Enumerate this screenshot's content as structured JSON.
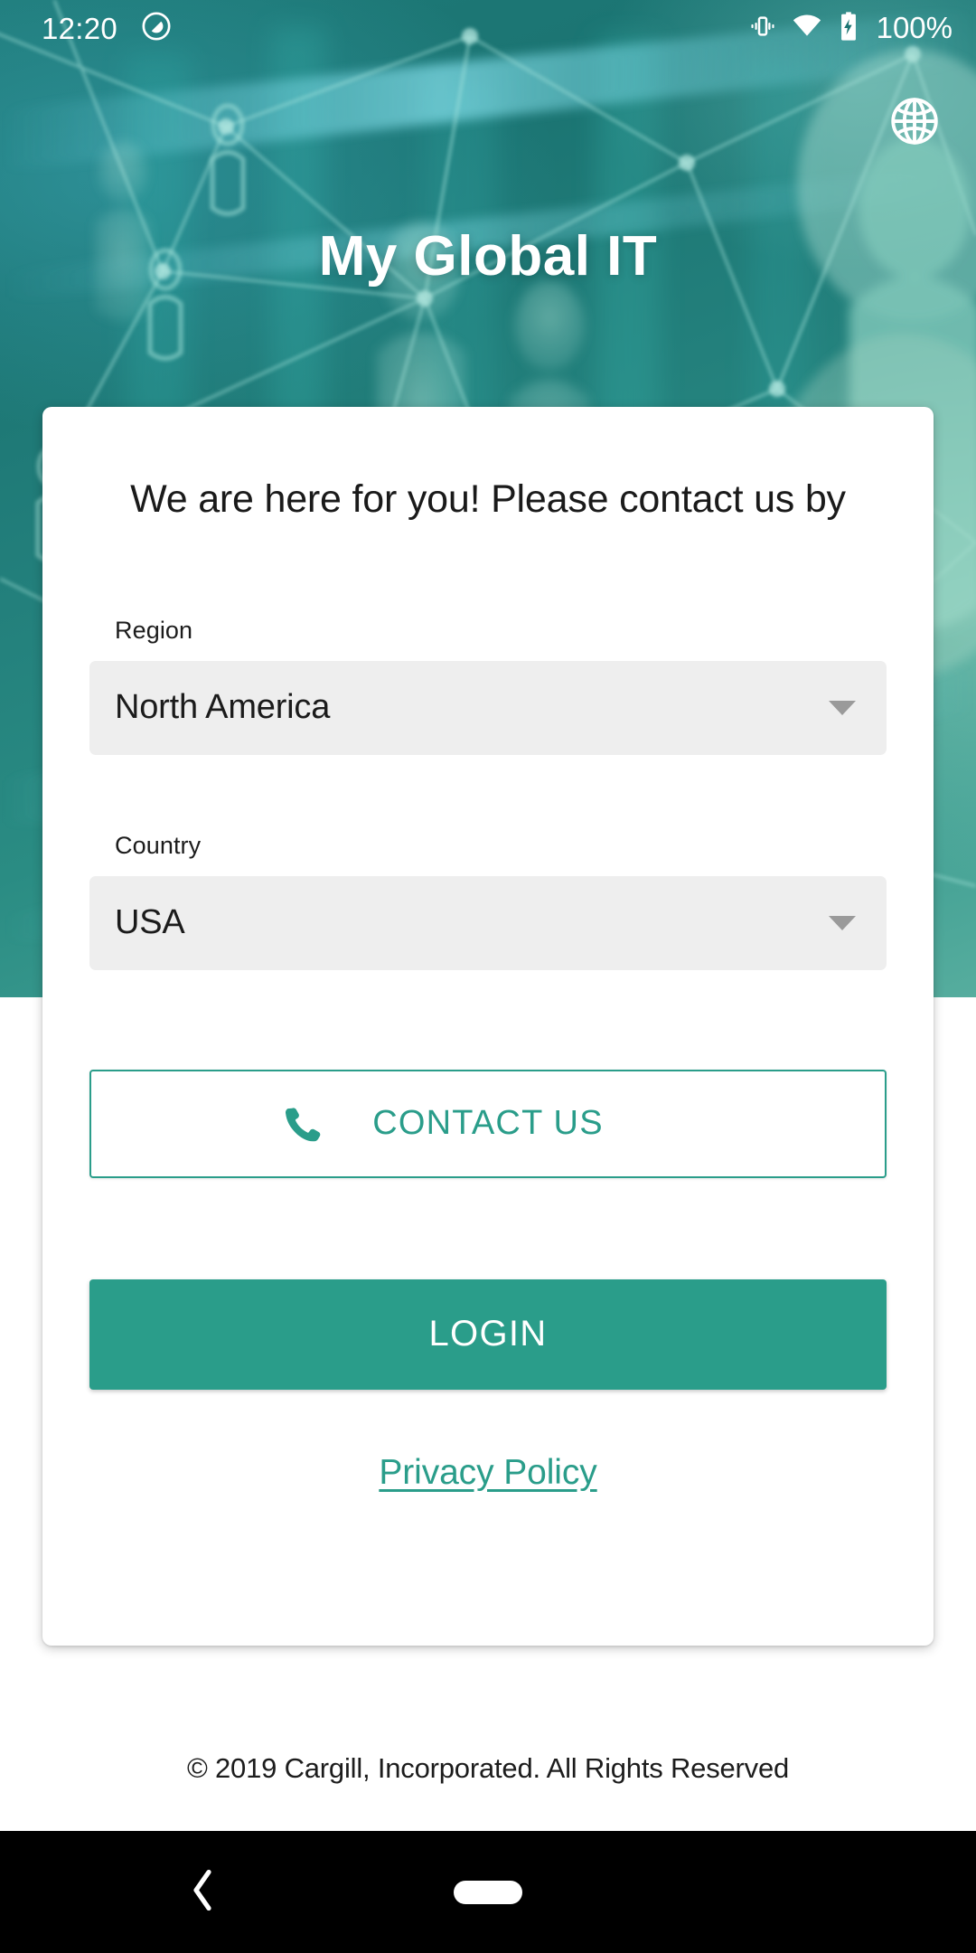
{
  "status_bar": {
    "time": "12:20",
    "dnd_icon": "do-not-disturb-icon",
    "vibrate_icon": "vibrate-icon",
    "wifi_icon": "wifi-icon",
    "battery_icon": "battery-charging-icon",
    "battery_percent": "100%"
  },
  "header": {
    "app_title": "My Global IT",
    "language_icon": "globe-icon"
  },
  "card": {
    "heading": "We are here for you! Please contact us by",
    "region": {
      "label": "Region",
      "value": "North America",
      "caret_icon": "chevron-down-icon"
    },
    "country": {
      "label": "Country",
      "value": "USA",
      "caret_icon": "chevron-down-icon"
    },
    "contact_button": {
      "label": "CONTACT US",
      "icon": "phone-icon"
    },
    "login_button": {
      "label": "LOGIN"
    },
    "privacy_link": {
      "label": "Privacy Policy"
    }
  },
  "footer": {
    "copyright": "© 2019 Cargill, Incorporated. All Rights Reserved"
  },
  "nav_bar": {
    "back_icon": "back-chevron-icon",
    "home_icon": "home-pill-icon"
  },
  "colors": {
    "accent_teal": "#2A9D8A",
    "hero_teal_dark": "#1B7472",
    "hero_teal_light": "#56AD9E",
    "field_grey": "#EEEEEE",
    "card_white": "#FFFFFF",
    "nav_black": "#000000"
  }
}
